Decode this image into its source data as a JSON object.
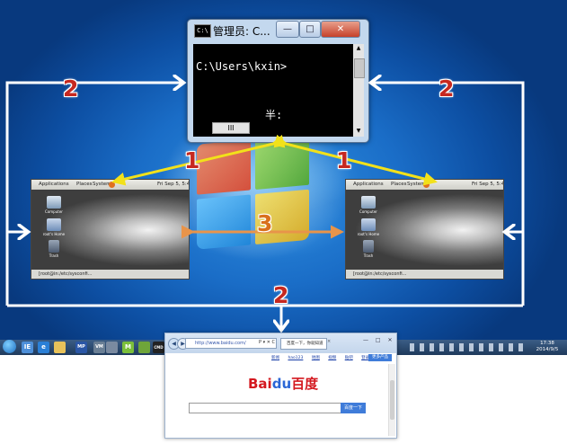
{
  "cmd": {
    "title": "管理员: C...",
    "icon_label": "C:\\",
    "prompt": "C:\\Users\\kxin>",
    "ime_status": "半:",
    "hscroll_thumb": "III",
    "buttons": {
      "minimize": "—",
      "maximize": "□",
      "close": "✕"
    }
  },
  "vm_left": {
    "menu": [
      "Applications",
      "Places",
      "System"
    ],
    "clock": "Fri Sep 5, 5:4",
    "desktop_icons": [
      "Computer",
      "root's Home",
      "Trash"
    ],
    "taskbar_item": "[root@in:/etc/sysconfi..."
  },
  "vm_right": {
    "menu": [
      "Applications",
      "Places",
      "System"
    ],
    "clock": "Fri Sep 5, 5:4",
    "desktop_icons": [
      "Computer",
      "root's Home",
      "Trash"
    ],
    "taskbar_item": "[root@in:/etc/sysconfi..."
  },
  "annotations": {
    "label_top_left": "2",
    "label_top_right": "2",
    "label_bottom": "2",
    "label_yellow_left": "1",
    "label_yellow_right": "1",
    "label_center": "3"
  },
  "taskbar": {
    "apps": [
      "IE",
      "e",
      "MP",
      "VM",
      "M",
      "CMD"
    ],
    "time": "17:38",
    "date": "2014/9/5"
  },
  "browser": {
    "url": "http://www.baidu.com/",
    "tab_title": "百度一下，你就知道",
    "links": [
      "新闻",
      "hao123",
      "地图",
      "视频",
      "贴吧",
      "登录",
      "设置"
    ],
    "login_button": "更多产品",
    "logo": {
      "bai": "Bai",
      "paw": "du",
      "cn": "百度"
    },
    "search_button": "百度一下",
    "address_controls": "P ▾ ✕ C"
  },
  "colors": {
    "arrow_white": "#ffffff",
    "arrow_yellow": "#f2e11a",
    "arrow_orange": "#e8944a",
    "number_red": "#c62820",
    "number_orange": "#d9701d"
  }
}
